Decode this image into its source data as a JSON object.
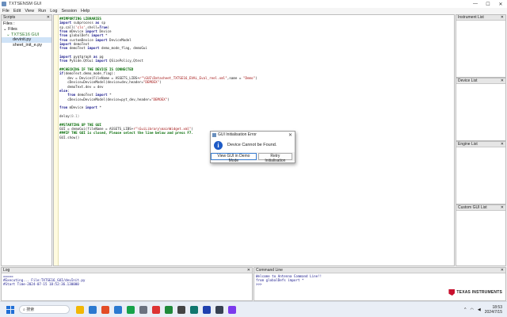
{
  "window": {
    "title": "TXTSENSM GUI",
    "controls": [
      "—",
      "☐",
      "✕"
    ]
  },
  "menu": [
    "File",
    "Edit",
    "View",
    "Run",
    "Log",
    "Session",
    "Help"
  ],
  "scripts_panel": {
    "title": "Scripts",
    "files_label": "Files :",
    "tree": [
      "Files",
      "TXTSE16 GUI",
      "devinit.py",
      "sheet_init_e.py"
    ]
  },
  "editor": {
    "lines": [
      [
        [
          "##IMPORTING LIBRARIES",
          "cm"
        ]
      ],
      [
        [
          "import ",
          "kw"
        ],
        [
          "subprocess ",
          "nt"
        ],
        [
          "as ",
          "kw"
        ],
        [
          "sp",
          "nt"
        ]
      ],
      [
        [
          "sp.call(",
          "nt"
        ],
        [
          "'cls'",
          "st"
        ],
        [
          ",shell=",
          "nt"
        ],
        [
          "True",
          "kw"
        ],
        [
          ")",
          "nt"
        ]
      ],
      [
        [
          "from ",
          "kw"
        ],
        [
          "mDevice ",
          "nt"
        ],
        [
          "import ",
          "kw"
        ],
        [
          "Device",
          "nt"
        ]
      ],
      [
        [
          "from ",
          "kw"
        ],
        [
          "globalDefs ",
          "nt"
        ],
        [
          "import ",
          "kw"
        ],
        [
          "*",
          "nt"
        ]
      ],
      [
        [
          "from ",
          "kw"
        ],
        [
          "customDevice ",
          "nt"
        ],
        [
          "import ",
          "kw"
        ],
        [
          "DeviceModel",
          "nt"
        ]
      ],
      [
        [
          "import ",
          "kw"
        ],
        [
          "demoText",
          "nt"
        ]
      ],
      [
        [
          "from ",
          "kw"
        ],
        [
          "demoText ",
          "nt"
        ],
        [
          "import ",
          "kw"
        ],
        [
          "demo_mode_flag, demoGui",
          "nt"
        ]
      ],
      [
        [
          "",
          "nt"
        ]
      ],
      [
        [
          "import ",
          "kw"
        ],
        [
          "pyqtgraph ",
          "nt"
        ],
        [
          "as ",
          "kw"
        ],
        [
          "pg",
          "nt"
        ]
      ],
      [
        [
          "from ",
          "kw"
        ],
        [
          "PySide.QtGui ",
          "nt"
        ],
        [
          "import ",
          "kw"
        ],
        [
          "QSizePolicy,Qtest",
          "nt"
        ]
      ],
      [
        [
          "",
          "nt"
        ]
      ],
      [
        [
          "##CHECKING IF THE DEVICE IS CONNECTED",
          "cm"
        ]
      ],
      [
        [
          "if",
          "kw"
        ],
        [
          "(demoText.demo_mode_flag):",
          "nt"
        ]
      ],
      [
        [
          "    dev = Device(FileName = ",
          "nt"
        ],
        [
          "ASSETS_LIBS",
          "nt"
        ],
        [
          "+",
          "nt"
        ],
        [
          "r\"\\GUI\\Datasheet_TXTSE16_EVAL_Eval_reel.xml\"",
          "st"
        ],
        [
          ",name = ",
          "nt"
        ],
        [
          "\"Demo\"",
          "st"
        ],
        [
          ")",
          "nt"
        ]
      ],
      [
        [
          "    cDevice=DeviceModel(device=dev,header=",
          "nt"
        ],
        [
          "\"DEMOEX\"",
          "st"
        ],
        [
          ")",
          "nt"
        ]
      ],
      [
        [
          "    demoText.dev = dev",
          "nt"
        ]
      ],
      [
        [
          "else",
          "kw"
        ],
        [
          ":",
          "nt"
        ]
      ],
      [
        [
          "    from ",
          "kw"
        ],
        [
          "demoText ",
          "nt"
        ],
        [
          "import ",
          "kw"
        ],
        [
          "*",
          "nt"
        ]
      ],
      [
        [
          "    cDevice=DeviceModel(device=pyt_dev,header=",
          "nt"
        ],
        [
          "\"DEMOEX\"",
          "st"
        ],
        [
          ")",
          "nt"
        ]
      ],
      [
        [
          "",
          "nt"
        ]
      ],
      [
        [
          "from ",
          "kw"
        ],
        [
          "mDevice ",
          "nt"
        ],
        [
          "import ",
          "kw"
        ],
        [
          "*",
          "nt"
        ]
      ],
      [
        [
          "",
          "nt"
        ]
      ],
      [
        [
          "delay",
          "nt"
        ],
        [
          "(0.1)",
          "dim"
        ]
      ],
      [
        [
          "",
          "nt"
        ]
      ],
      [
        [
          "##STARTING UP THE GUI",
          "cm"
        ]
      ],
      [
        [
          "GUI = demoGui(fileName = ",
          "nt"
        ],
        [
          "ASSETS_LIBS",
          "nt"
        ],
        [
          "+",
          "nt"
        ],
        [
          "r\"\\GuiLibrary\\mainWidget.xml\"",
          "st"
        ],
        [
          ")",
          "nt"
        ]
      ],
      [
        [
          "###IF THE GUI is closed, Please select the line below and press F7.",
          "cm"
        ]
      ],
      [
        [
          "GUI.show()",
          "nt"
        ]
      ]
    ]
  },
  "right_panels": [
    "Instrument List",
    "Device List",
    "Engine List",
    "Custom GUI List"
  ],
  "log_panel": {
    "title": "Log",
    "lines": [
      "=====",
      "#Executing... File:TXTSE16_GUI/devInit.py",
      "#Start Time-2024-07-15 18:52:36.130000"
    ]
  },
  "cmd_panel": {
    "title": "Command Line",
    "lines": [
      "Welcome to Antenna Command Line!!",
      "from globalDefs import *",
      ">>>"
    ]
  },
  "brand": "TEXAS INSTRUMENTS",
  "dialog": {
    "title": "GUI Initialisation Error",
    "message": "Device Cannot be Found.",
    "btn_demo": "View GUI in Demo Mode",
    "btn_retry": "Retry Initialisation",
    "close": "✕"
  },
  "taskbar": {
    "search_placeholder": "搜索",
    "time": "18:53",
    "date": "2024/7/15",
    "app_colors": [
      "#f2b705",
      "#2b79d0",
      "#e34c26",
      "#2b79d0",
      "#16a34a",
      "#6b7280",
      "#d33",
      "#1f8a3a",
      "#444",
      "#0f766e",
      "#1e40af",
      "#374151",
      "#7c3aed"
    ]
  },
  "colors": {
    "accent": "#1e5bc6",
    "brand_red": "#c8102e"
  }
}
